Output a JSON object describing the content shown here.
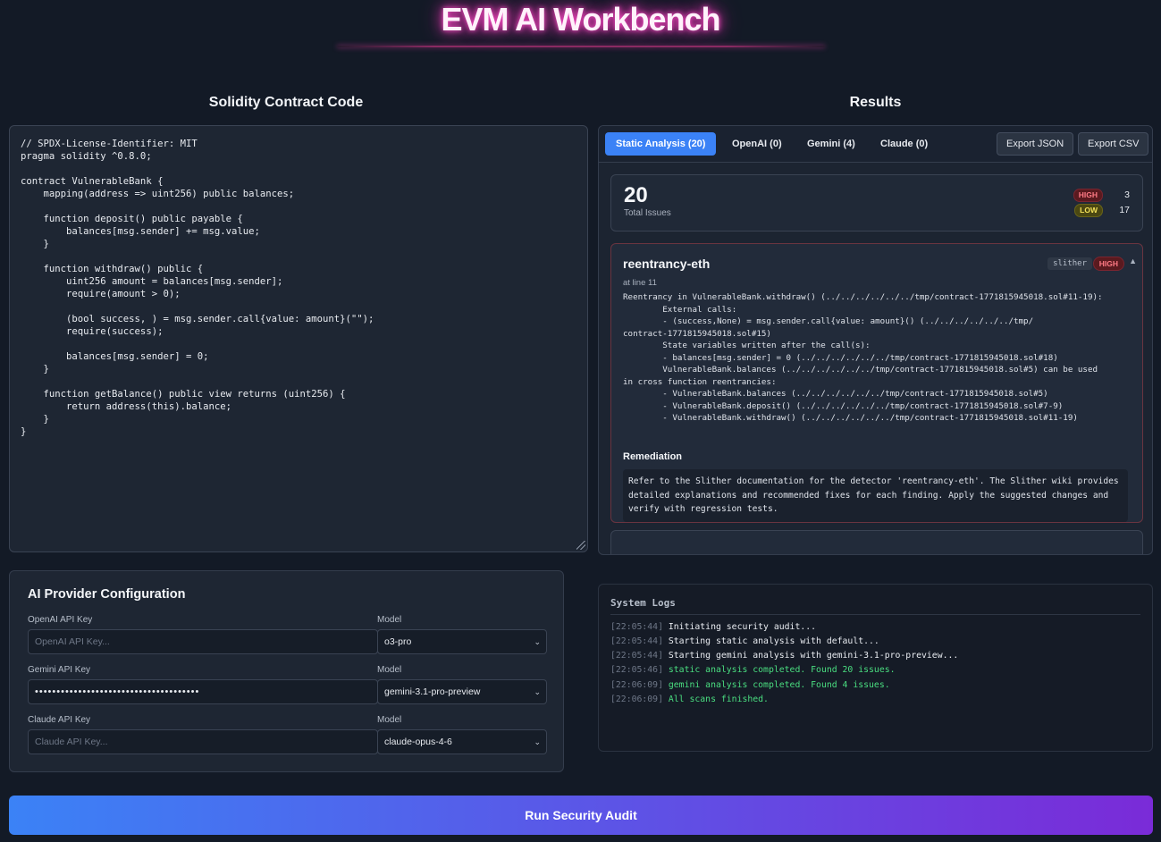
{
  "app": {
    "title": "EVM AI Workbench"
  },
  "left": {
    "heading": "Solidity Contract Code",
    "code": "// SPDX-License-Identifier: MIT\npragma solidity ^0.8.0;\n\ncontract VulnerableBank {\n    mapping(address => uint256) public balances;\n\n    function deposit() public payable {\n        balances[msg.sender] += msg.value;\n    }\n\n    function withdraw() public {\n        uint256 amount = balances[msg.sender];\n        require(amount > 0);\n\n        (bool success, ) = msg.sender.call{value: amount}(\"\");\n        require(success);\n\n        balances[msg.sender] = 0;\n    }\n\n    function getBalance() public view returns (uint256) {\n        return address(this).balance;\n    }\n}"
  },
  "results": {
    "heading": "Results",
    "tabs": [
      {
        "label": "Static Analysis (20)",
        "active": true
      },
      {
        "label": "OpenAI (0)",
        "active": false
      },
      {
        "label": "Gemini (4)",
        "active": false
      },
      {
        "label": "Claude (0)",
        "active": false
      }
    ],
    "export_json": "Export JSON",
    "export_csv": "Export CSV",
    "summary": {
      "total": "20",
      "total_label": "Total Issues",
      "high_label": "HIGH",
      "high_count": "3",
      "low_label": "LOW",
      "low_count": "17"
    },
    "finding": {
      "title": "reentrancy-eth",
      "tool": "slither",
      "severity": "HIGH",
      "collapse_glyph": "▲",
      "line": "at line 11",
      "description": "Reentrancy in VulnerableBank.withdraw() (../../../../../../tmp/contract-1771815945018.sol#11-19):\n\tExternal calls:\n\t- (success,None) = msg.sender.call{value: amount}() (../../../../../../tmp/\ncontract-1771815945018.sol#15)\n\tState variables written after the call(s):\n\t- balances[msg.sender] = 0 (../../../../../../tmp/contract-1771815945018.sol#18)\n\tVulnerableBank.balances (../../../../../../tmp/contract-1771815945018.sol#5) can be used\nin cross function reentrancies:\n\t- VulnerableBank.balances (../../../../../../tmp/contract-1771815945018.sol#5)\n\t- VulnerableBank.deposit() (../../../../../../tmp/contract-1771815945018.sol#7-9)\n\t- VulnerableBank.withdraw() (../../../../../../tmp/contract-1771815945018.sol#11-19)",
      "remediation_title": "Remediation",
      "remediation": "Refer to the Slither documentation for the detector 'reentrancy-eth'. The Slither wiki provides detailed explanations and recommended fixes for each finding. Apply the suggested changes and verify with regression tests."
    }
  },
  "config": {
    "title": "AI Provider Configuration",
    "providers": [
      {
        "key_label": "OpenAI API Key",
        "key_value": "",
        "key_placeholder": "OpenAI API Key...",
        "model_label": "Model",
        "model": "o3-pro"
      },
      {
        "key_label": "Gemini API Key",
        "key_value": "••••••••••••••••••••••••••••••••••••••",
        "key_placeholder": "",
        "model_label": "Model",
        "model": "gemini-3.1-pro-preview"
      },
      {
        "key_label": "Claude API Key",
        "key_value": "",
        "key_placeholder": "Claude API Key...",
        "model_label": "Model",
        "model": "claude-opus-4-6"
      }
    ]
  },
  "logs": {
    "title": "System Logs",
    "entries": [
      {
        "time": "[22:05:44]",
        "text": "Initiating security audit...",
        "type": "info"
      },
      {
        "time": "[22:05:44]",
        "text": "Starting static analysis with default...",
        "type": "info"
      },
      {
        "time": "[22:05:44]",
        "text": "Starting gemini analysis with gemini-3.1-pro-preview...",
        "type": "info"
      },
      {
        "time": "[22:05:46]",
        "text": "static analysis completed. Found 20 issues.",
        "type": "success"
      },
      {
        "time": "[22:06:09]",
        "text": "gemini analysis completed. Found 4 issues.",
        "type": "success"
      },
      {
        "time": "[22:06:09]",
        "text": "All scans finished.",
        "type": "success"
      }
    ]
  },
  "run_button": "Run Security Audit",
  "colors": {
    "accent": "#3b82f6",
    "gradient_end": "#7a2bd8",
    "high": "#ff7a85",
    "low": "#f3e25a",
    "success": "#4ade80"
  }
}
